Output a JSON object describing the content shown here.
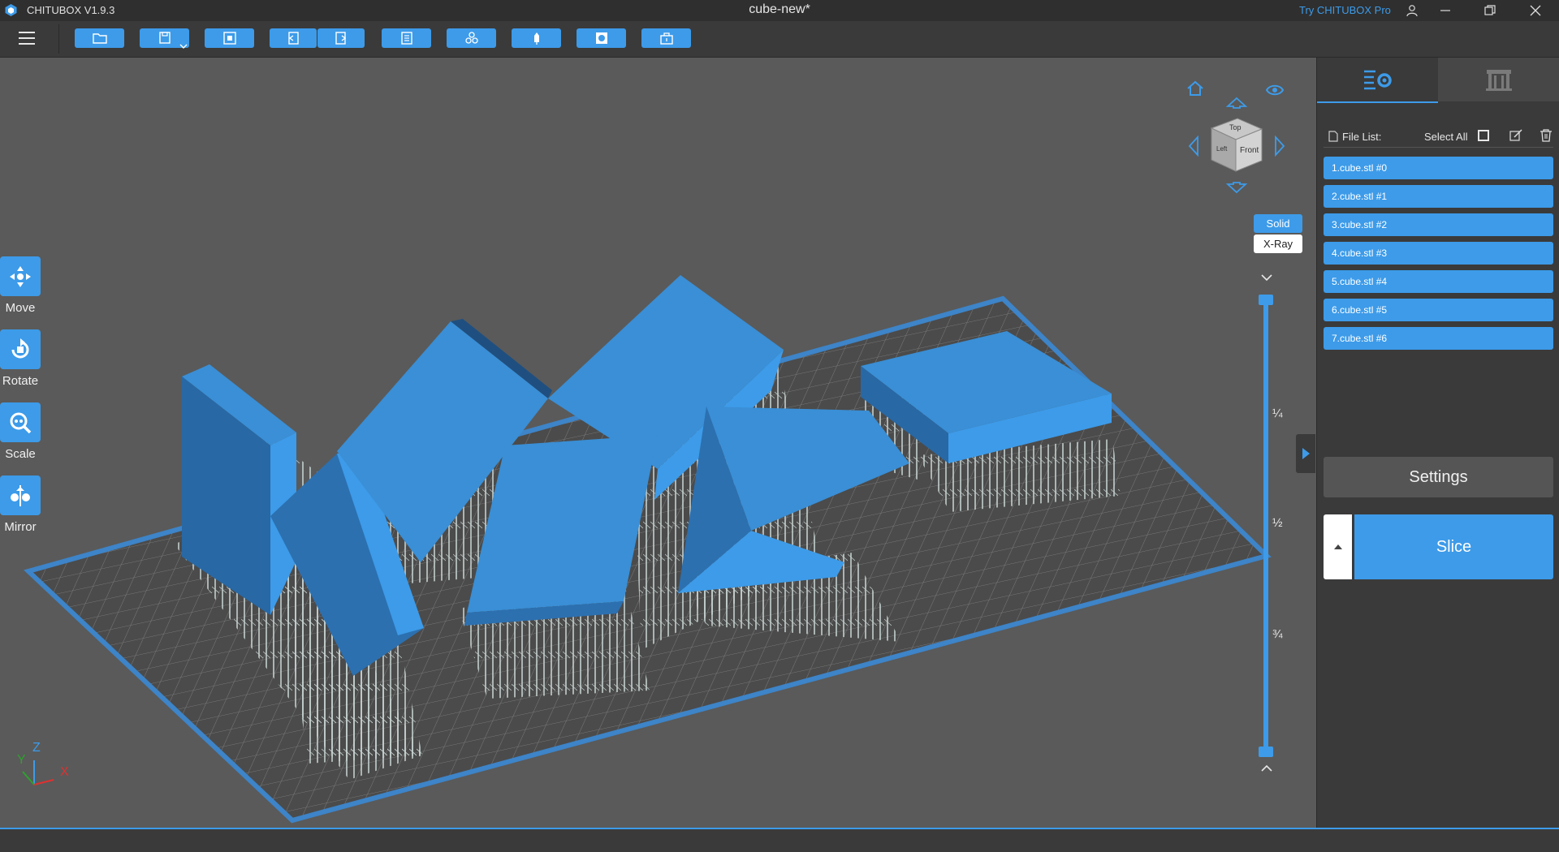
{
  "app": {
    "name": "CHITUBOX V1.9.3",
    "document_title": "cube-new*",
    "try_pro": "Try CHITUBOX Pro"
  },
  "toolbar": {
    "buttons": [
      "open-file",
      "save",
      "center",
      "import",
      "export",
      "layout",
      "arrange",
      "support",
      "hollow",
      "dig-hole"
    ]
  },
  "tools": [
    {
      "label": "Move",
      "icon": "move-icon"
    },
    {
      "label": "Rotate",
      "icon": "rotate-icon"
    },
    {
      "label": "Scale",
      "icon": "scale-icon"
    },
    {
      "label": "Mirror",
      "icon": "mirror-icon"
    }
  ],
  "view_cube": {
    "top": "Top",
    "front": "Front",
    "left": "Left"
  },
  "view_modes": {
    "solid": "Solid",
    "xray": "X-Ray",
    "active": "Solid"
  },
  "layer_slider": {
    "ticks": [
      "¼",
      "½",
      "¾"
    ],
    "top_value": 1.0,
    "bottom_value": 0.0
  },
  "axes": {
    "x": "X",
    "y": "Y",
    "z": "Z"
  },
  "right_panel": {
    "file_list_label": "File List:",
    "select_all_label": "Select All",
    "files": [
      "1.cube.stl #0",
      "2.cube.stl #1",
      "3.cube.stl #2",
      "4.cube.stl #3",
      "5.cube.stl #4",
      "6.cube.stl #5",
      "7.cube.stl #6"
    ],
    "settings_label": "Settings",
    "slice_label": "Slice"
  },
  "colors": {
    "accent": "#3d9be9",
    "model_top": "#3a8fd6",
    "model_side": "#2868a4",
    "support": "#c9d6d4",
    "plate_border": "#3d84c8",
    "background": "#5a5a5a"
  }
}
